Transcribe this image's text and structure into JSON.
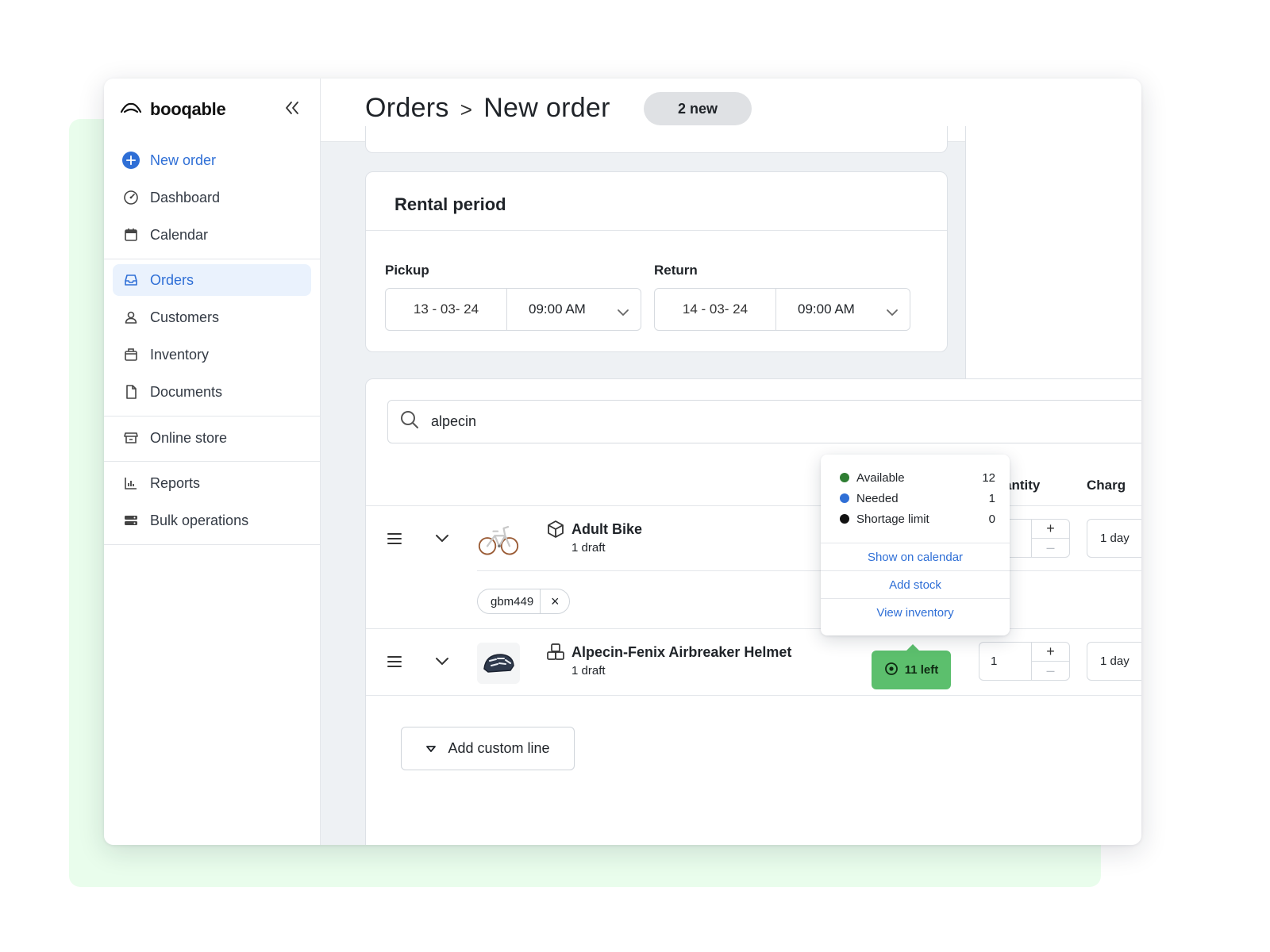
{
  "brand": {
    "name": "booqable",
    "logo_icon": "booqable-logo-icon",
    "collapse_icon": "double-chevron-left-icon"
  },
  "nav": {
    "new_order": {
      "label": "New order",
      "icon": "plus-circle-icon",
      "color": "#2f6fd6"
    },
    "items": [
      {
        "label": "Dashboard",
        "icon": "dashboard-gauge-icon"
      },
      {
        "label": "Calendar",
        "icon": "calendar-icon"
      },
      {
        "label": "Orders",
        "icon": "inbox-tray-icon",
        "active": true
      },
      {
        "label": "Customers",
        "icon": "person-icon"
      },
      {
        "label": "Inventory",
        "icon": "box-icon"
      },
      {
        "label": "Documents",
        "icon": "document-icon"
      },
      {
        "label": "Online store",
        "icon": "storefront-icon"
      },
      {
        "label": "Reports",
        "icon": "bar-chart-icon"
      },
      {
        "label": "Bulk operations",
        "icon": "bulk-operations-icon"
      }
    ]
  },
  "header": {
    "crumb_root": "Orders",
    "crumb_separator": ">",
    "crumb_current": "New order",
    "badge": "2 new"
  },
  "rental_period": {
    "title": "Rental period",
    "pickup": {
      "label": "Pickup",
      "date": "13 - 03- 24",
      "time": "09:00 AM"
    },
    "return": {
      "label": "Return",
      "date": "14 - 03- 24",
      "time": "09:00 AM"
    }
  },
  "search": {
    "value": "alpecin",
    "icon": "search-icon"
  },
  "columns": {
    "quantity": "antity",
    "charge": "Charg"
  },
  "lines": [
    {
      "name": "Adult Bike",
      "sub": "1 draft",
      "type_icon": "product-box-icon",
      "thumb": "bike-thumbnail",
      "tag": "gbm449",
      "tag_remove": "×",
      "quantity": "",
      "charge": "1 day"
    },
    {
      "name": "Alpecin-Fenix Airbreaker Helmet",
      "sub": "1 draft",
      "type_icon": "bundle-boxes-icon",
      "thumb": "helmet-thumbnail",
      "availability": "11 left",
      "quantity": "1",
      "charge": "1 day"
    }
  ],
  "stepper": {
    "plus": "+",
    "minus": "–"
  },
  "add_custom_line": "Add custom line",
  "availability_popover": {
    "rows": [
      {
        "label": "Available",
        "value": "12",
        "color": "#2e7d32"
      },
      {
        "label": "Needed",
        "value": "1",
        "color": "#2f6fd6"
      },
      {
        "label": "Shortage limit",
        "value": "0",
        "color": "#111111"
      }
    ],
    "links": [
      "Show on calendar",
      "Add stock",
      "View inventory"
    ]
  },
  "colors": {
    "accent_blue": "#2f6fd6",
    "available_green": "#5cbf6d",
    "background_mint": "#e9fdec"
  }
}
